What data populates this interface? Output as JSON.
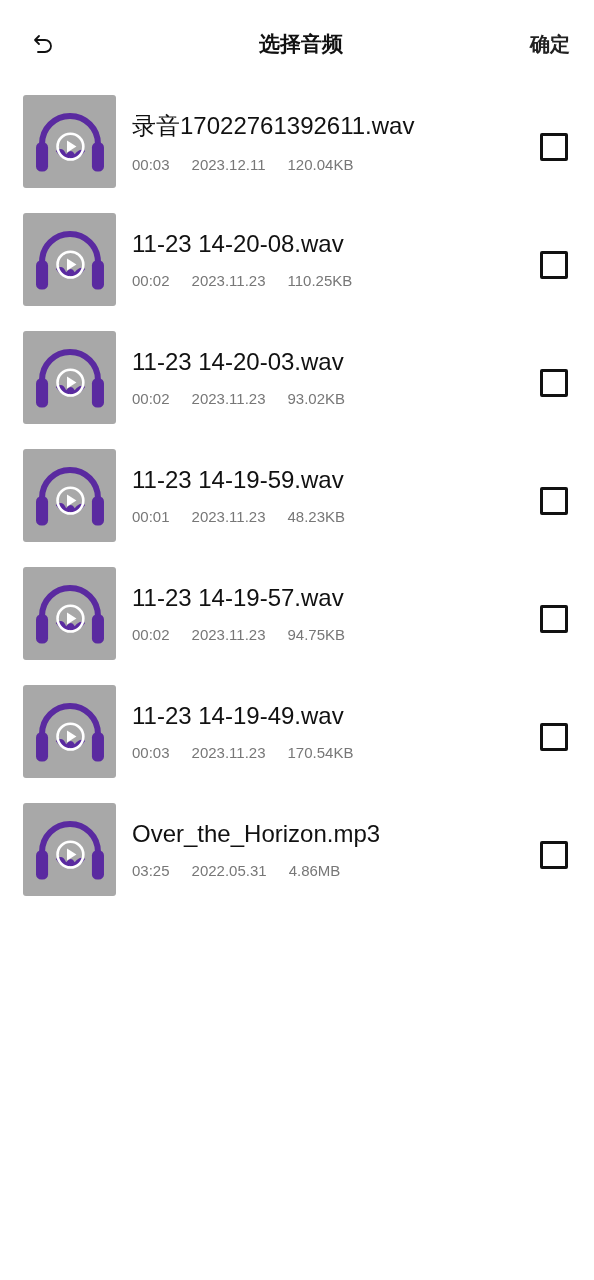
{
  "header": {
    "title": "选择音频",
    "confirm": "确定"
  },
  "files": [
    {
      "name": "录音17022761392611.wav",
      "duration": "00:03",
      "date": "2023.12.11",
      "size": "120.04KB",
      "checked": false
    },
    {
      "name": "11-23 14-20-08.wav",
      "duration": "00:02",
      "date": "2023.11.23",
      "size": "110.25KB",
      "checked": false
    },
    {
      "name": "11-23 14-20-03.wav",
      "duration": "00:02",
      "date": "2023.11.23",
      "size": "93.02KB",
      "checked": false
    },
    {
      "name": "11-23 14-19-59.wav",
      "duration": "00:01",
      "date": "2023.11.23",
      "size": "48.23KB",
      "checked": false
    },
    {
      "name": "11-23 14-19-57.wav",
      "duration": "00:02",
      "date": "2023.11.23",
      "size": "94.75KB",
      "checked": false
    },
    {
      "name": "11-23 14-19-49.wav",
      "duration": "00:03",
      "date": "2023.11.23",
      "size": "170.54KB",
      "checked": false
    },
    {
      "name": "Over_the_Horizon.mp3",
      "duration": "03:25",
      "date": "2022.05.31",
      "size": "4.86MB",
      "checked": false
    }
  ]
}
